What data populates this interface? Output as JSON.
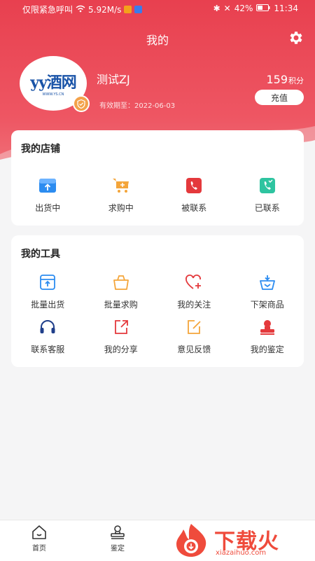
{
  "status_bar": {
    "left_text": "仅限紧急呼叫",
    "speed": "5.92M/s",
    "battery": "42%",
    "time": "11:34"
  },
  "header": {
    "title": "我的"
  },
  "profile": {
    "logo_text": "yy酒网",
    "logo_sub": "WWW.YS.CN",
    "username": "测试ZJ",
    "validity": "有效期至：2022-06-03",
    "points_value": "159",
    "points_unit": "积分",
    "recharge_label": "充值"
  },
  "my_store": {
    "title": "我的店铺",
    "items": [
      {
        "label": "出货中",
        "icon": "shipping-icon"
      },
      {
        "label": "求购中",
        "icon": "cart-icon"
      },
      {
        "label": "被联系",
        "icon": "phone-incoming-icon"
      },
      {
        "label": "已联系",
        "icon": "phone-contacted-icon"
      }
    ]
  },
  "my_tools": {
    "title": "我的工具",
    "items": [
      {
        "label": "批量出货",
        "icon": "batch-ship-icon"
      },
      {
        "label": "批量求购",
        "icon": "batch-buy-icon"
      },
      {
        "label": "我的关注",
        "icon": "heart-plus-icon"
      },
      {
        "label": "下架商品",
        "icon": "basket-down-icon"
      },
      {
        "label": "联系客服",
        "icon": "headset-icon"
      },
      {
        "label": "我的分享",
        "icon": "share-icon"
      },
      {
        "label": "意见反馈",
        "icon": "feedback-icon"
      },
      {
        "label": "我的鉴定",
        "icon": "stamp-icon"
      }
    ]
  },
  "tab_bar": {
    "items": [
      {
        "label": "首页",
        "icon": "home-icon"
      },
      {
        "label": "鉴定",
        "icon": "appraise-icon"
      }
    ]
  },
  "watermark": {
    "text": "下载火",
    "sub": "xiazaihuo.com"
  },
  "colors": {
    "brand": "#e8404f",
    "blue": "#2c8cf0",
    "orange": "#f4a53a",
    "red": "#e4393c",
    "green": "#2ec4a0"
  }
}
